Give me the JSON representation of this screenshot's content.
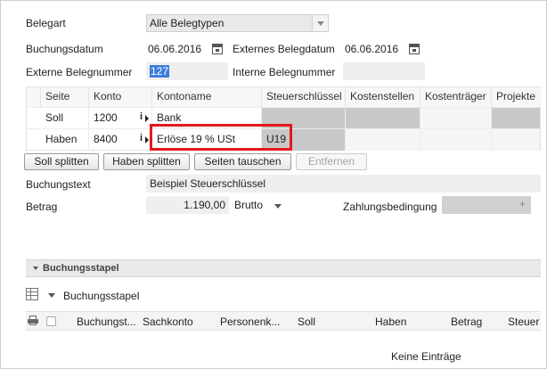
{
  "form": {
    "belegart_label": "Belegart",
    "belegart_value": "Alle Belegtypen",
    "buchungsdatum_label": "Buchungsdatum",
    "buchungsdatum_value": "06.06.2016",
    "externes_belegdatum_label": "Externes Belegdatum",
    "externes_belegdatum_value": "06.06.2016",
    "externe_belegnummer_label": "Externe Belegnummer",
    "externe_belegnummer_value": "127",
    "interne_belegnummer_label": "Interne Belegnummer",
    "interne_belegnummer_value": "",
    "buchungstext_label": "Buchungstext",
    "buchungstext_value": "Beispiel Steuerschlüssel",
    "betrag_label": "Betrag",
    "betrag_value": "1.190,00",
    "betrag_mode": "Brutto",
    "zahlungsbedingung_label": "Zahlungsbedingung",
    "zahlungsbedingung_value": ""
  },
  "grid": {
    "headers": [
      "Seite",
      "Konto",
      "Kontoname",
      "Steuerschlüssel",
      "Kostenstellen",
      "Kostenträger",
      "Projekte"
    ],
    "rows": [
      {
        "seite": "Soll",
        "konto": "1200",
        "kontoname": "Bank",
        "steuer": ""
      },
      {
        "seite": "Haben",
        "konto": "8400",
        "kontoname": "Erlöse 19 % USt",
        "steuer": "U19"
      }
    ]
  },
  "buttons": {
    "soll_splitten": "Soll splitten",
    "haben_splitten": "Haben splitten",
    "seiten_tauschen": "Seiten tauschen",
    "entfernen": "Entfernen"
  },
  "stapel": {
    "panel_title": "Buchungsstapel",
    "dropdown_label": "Buchungsstapel",
    "columns": [
      "Buchungst...",
      "Sachkonto",
      "Personenk...",
      "Soll",
      "Haben",
      "Betrag",
      "Steuer"
    ],
    "empty_text": "Keine Einträge"
  },
  "colors": {
    "highlight": "#e3191c",
    "selection": "#3c7ee0"
  }
}
